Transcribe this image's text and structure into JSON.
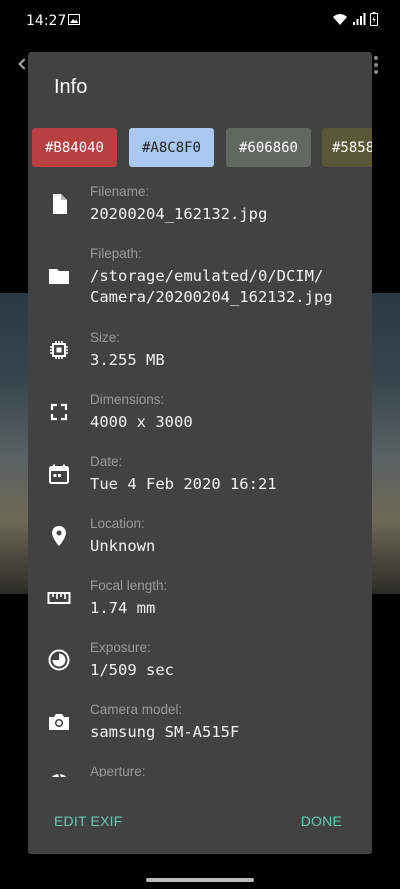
{
  "status_bar": {
    "time": "14:27"
  },
  "dialog": {
    "title": "Info",
    "swatches": [
      {
        "label": "#B84040",
        "color": "#B84040",
        "text_color": "#ffffff"
      },
      {
        "label": "#A8C8F0",
        "color": "#A8C8F0",
        "text_color": "#222222"
      },
      {
        "label": "#606860",
        "color": "#606860",
        "text_color": "#ffffff"
      },
      {
        "label": "#5858",
        "color": "#585838",
        "text_color": "#ffffff"
      }
    ],
    "rows": [
      {
        "label": "Filename:",
        "value": "20200204_162132.jpg"
      },
      {
        "label": "Filepath:",
        "value_line1": "/storage/emulated/0/DCIM/",
        "value_line2": "Camera/20200204_162132.jpg"
      },
      {
        "label": "Size:",
        "value": "3.255 MB"
      },
      {
        "label": "Dimensions:",
        "value": "4000 x 3000"
      },
      {
        "label": "Date:",
        "value": "Tue 4 Feb 2020 16:21"
      },
      {
        "label": "Location:",
        "value": "Unknown"
      },
      {
        "label": "Focal length:",
        "value": "1.74 mm"
      },
      {
        "label": "Exposure:",
        "value": "1/509 sec"
      },
      {
        "label": "Camera model:",
        "value": "samsung SM-A515F"
      },
      {
        "label": "Aperture:",
        "value": ""
      }
    ],
    "edit_exif_label": "EDIT EXIF",
    "done_label": "DONE"
  },
  "colors": {
    "dialog_bg": "#424242",
    "accent": "#69c9b0"
  }
}
